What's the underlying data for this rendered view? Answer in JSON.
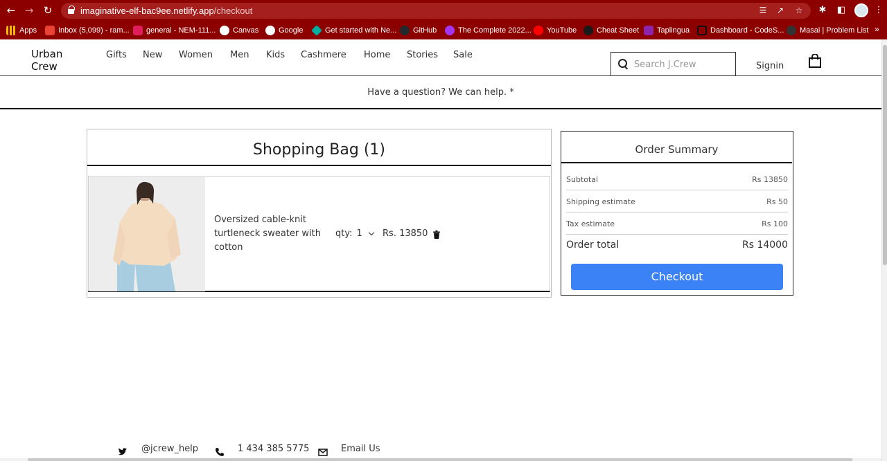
{
  "browser": {
    "url_host": "imaginative-elf-bac9ee.netlify.app",
    "url_path": "/checkout",
    "bookmarks": [
      {
        "label": "Apps",
        "color": "#fbbc04"
      },
      {
        "label": "Inbox (5,099) - ram...",
        "color": "#ea4335"
      },
      {
        "label": "general - NEM-111...",
        "color": "#4a154b"
      },
      {
        "label": "Canvas",
        "color": "#e0e0e0"
      },
      {
        "label": "Google",
        "color": "#ffffff"
      },
      {
        "label": "Get started with Ne...",
        "color": "#00ad9f"
      },
      {
        "label": "GitHub",
        "color": "#24292e"
      },
      {
        "label": "The Complete 2022...",
        "color": "#a435f0"
      },
      {
        "label": "YouTube",
        "color": "#ff0000"
      },
      {
        "label": "Cheat Sheet",
        "color": "#1a1a1a"
      },
      {
        "label": "Taplingua",
        "color": "#8e24aa"
      },
      {
        "label": "Dashboard - CodeS...",
        "color": "#5c0000"
      },
      {
        "label": "Masai | Problem List",
        "color": "#333333"
      }
    ],
    "more_label": "»"
  },
  "header": {
    "logo": "Urban Crew",
    "nav": [
      "Gifts",
      "New",
      "Women",
      "Men",
      "Kids",
      "Cashmere",
      "Home",
      "Stories",
      "Sale"
    ],
    "search_placeholder": "Search J.Crew",
    "signin": "Signin"
  },
  "help_bar": "Have a question? We can help. *",
  "bag": {
    "title": "Shopping Bag (1)",
    "items": [
      {
        "name": "Oversized cable-knit turtleneck sweater with cotton",
        "qty_label": "qty:",
        "qty": "1",
        "price": "Rs. 13850"
      }
    ]
  },
  "summary": {
    "title": "Order Summary",
    "rows": [
      {
        "label": "Subtotal",
        "value": "Rs 13850"
      },
      {
        "label": "Shipping estimate",
        "value": "Rs 50"
      },
      {
        "label": "Tax estimate",
        "value": "Rs 100"
      }
    ],
    "total_label": "Order total",
    "total_value": "Rs 14000",
    "checkout": "Checkout",
    "accent": "#3b82f6"
  },
  "footer": {
    "twitter": "@jcrew_help",
    "phone": "1 434 385 5775",
    "email": "Email Us"
  }
}
